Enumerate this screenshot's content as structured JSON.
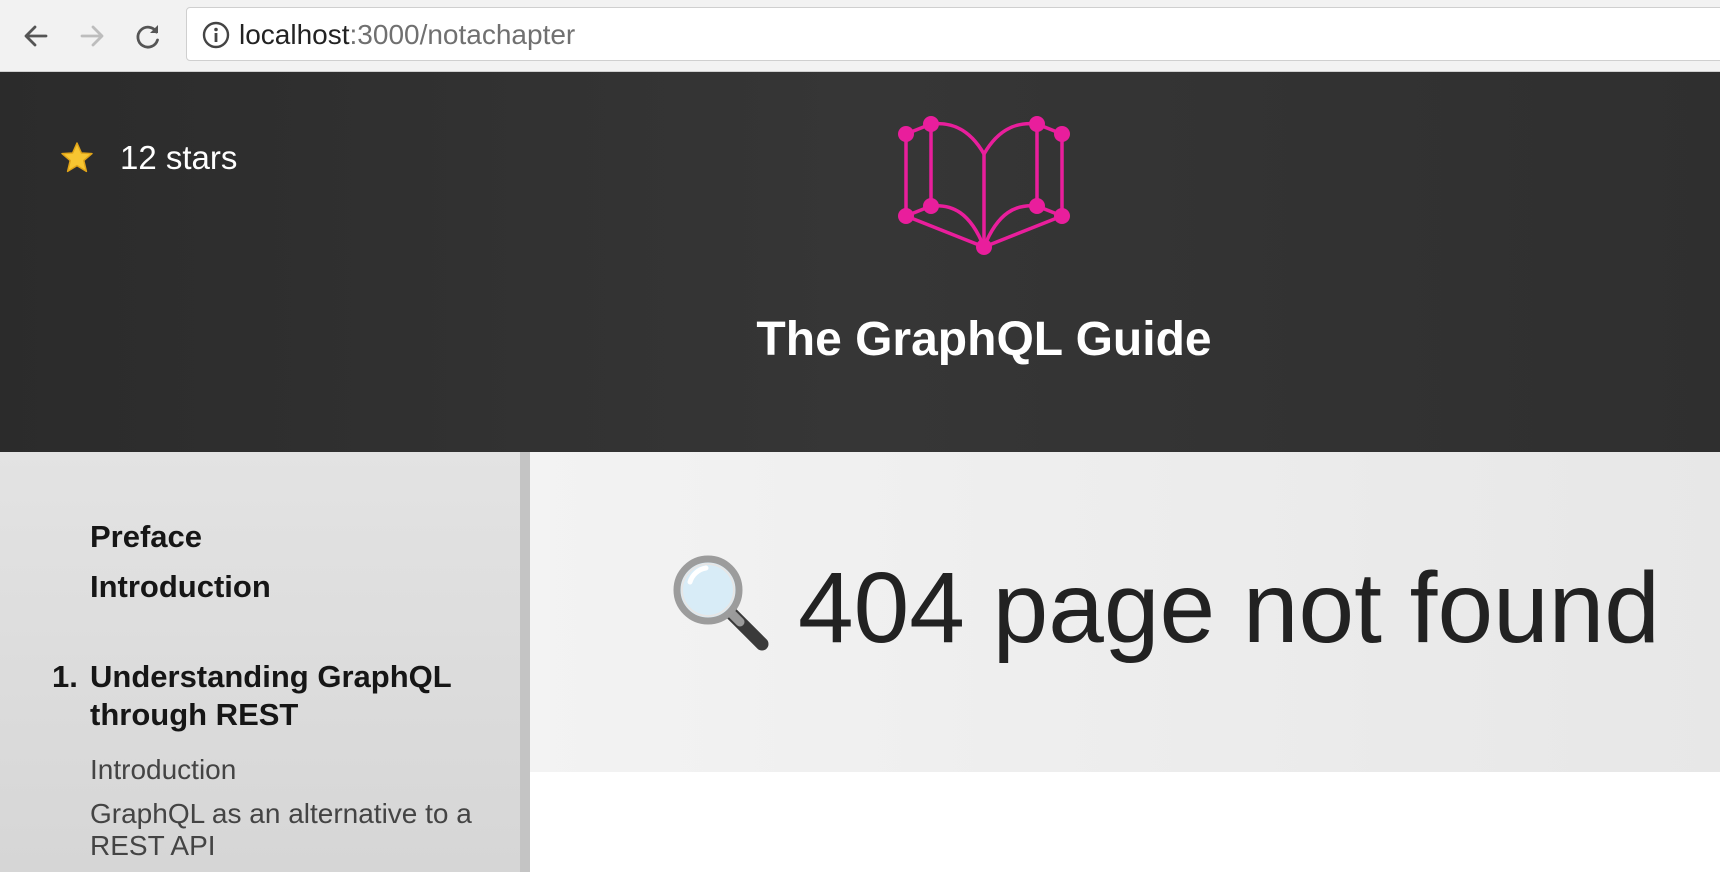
{
  "browser": {
    "url_host": "localhost",
    "url_path": ":3000/notachapter"
  },
  "header": {
    "stars_label": "12 stars",
    "title": "The GraphQL Guide",
    "brand_color": "#e91e9c"
  },
  "sidebar": {
    "items": [
      {
        "label": "Preface"
      },
      {
        "label": "Introduction"
      }
    ],
    "chapter": {
      "number": "1.",
      "title": "Understanding GraphQL through REST",
      "sections": [
        {
          "label": "Introduction"
        },
        {
          "label": "GraphQL as an alternative to a REST API"
        }
      ]
    }
  },
  "main": {
    "heading": "404 page not found"
  }
}
